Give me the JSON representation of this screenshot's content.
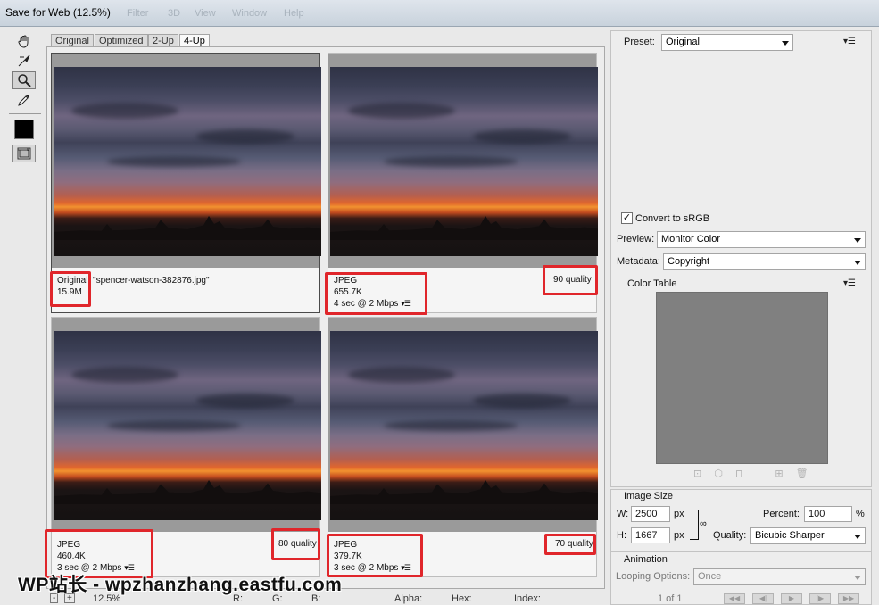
{
  "window": {
    "title": "Save for Web (12.5%)"
  },
  "menu_ghost": [
    "Filter",
    "3D",
    "View",
    "Window",
    "Help"
  ],
  "tools": [
    {
      "name": "hand-icon",
      "active": false
    },
    {
      "name": "slice-select-icon",
      "active": false
    },
    {
      "name": "zoom-icon",
      "active": true
    },
    {
      "name": "eyedropper-icon",
      "active": false
    }
  ],
  "tabs": [
    {
      "label": "Original",
      "active": false
    },
    {
      "label": "Optimized",
      "active": false
    },
    {
      "label": "2-Up",
      "active": false
    },
    {
      "label": "4-Up",
      "active": true
    }
  ],
  "panes": [
    {
      "format": "Original: \"spencer-watson-382876.jpg\"",
      "size": "15.9M",
      "time": "",
      "quality": ""
    },
    {
      "format": "JPEG",
      "size": "655.7K",
      "time": "4 sec @ 2 Mbps",
      "quality": "90 quality"
    },
    {
      "format": "JPEG",
      "size": "460.4K",
      "time": "3 sec @ 2 Mbps",
      "quality": "80 quality"
    },
    {
      "format": "JPEG",
      "size": "379.7K",
      "time": "3 sec @ 2 Mbps",
      "quality": "70 quality"
    }
  ],
  "settings": {
    "preset_label": "Preset:",
    "preset_value": "Original",
    "convert_srgb_label": "Convert to sRGB",
    "convert_srgb_checked": true,
    "preview_label": "Preview:",
    "preview_value": "Monitor Color",
    "metadata_label": "Metadata:",
    "metadata_value": "Copyright"
  },
  "color_table": {
    "title": "Color Table"
  },
  "image_size": {
    "title": "Image Size",
    "w_label": "W:",
    "w_value": "2500",
    "h_label": "H:",
    "h_value": "1667",
    "unit": "px",
    "percent_label": "Percent:",
    "percent_value": "100",
    "percent_unit": "%",
    "quality_label": "Quality:",
    "quality_value": "Bicubic Sharper"
  },
  "animation": {
    "title": "Animation",
    "looping_label": "Looping Options:",
    "looping_value": "Once",
    "frame_counter": "1 of 1"
  },
  "status_bar": {
    "zoom": "12.5%",
    "r_label": "R:",
    "g_label": "G:",
    "b_label": "B:",
    "alpha_label": "Alpha:",
    "hex_label": "Hex:",
    "index_label": "Index:"
  },
  "watermark": "WP站长 - wpzhanzhang.eastfu.com",
  "colors": {
    "highlight_box": "#e0262b",
    "panel_bg": "#ededed",
    "color_table_swatch": "#808080"
  }
}
